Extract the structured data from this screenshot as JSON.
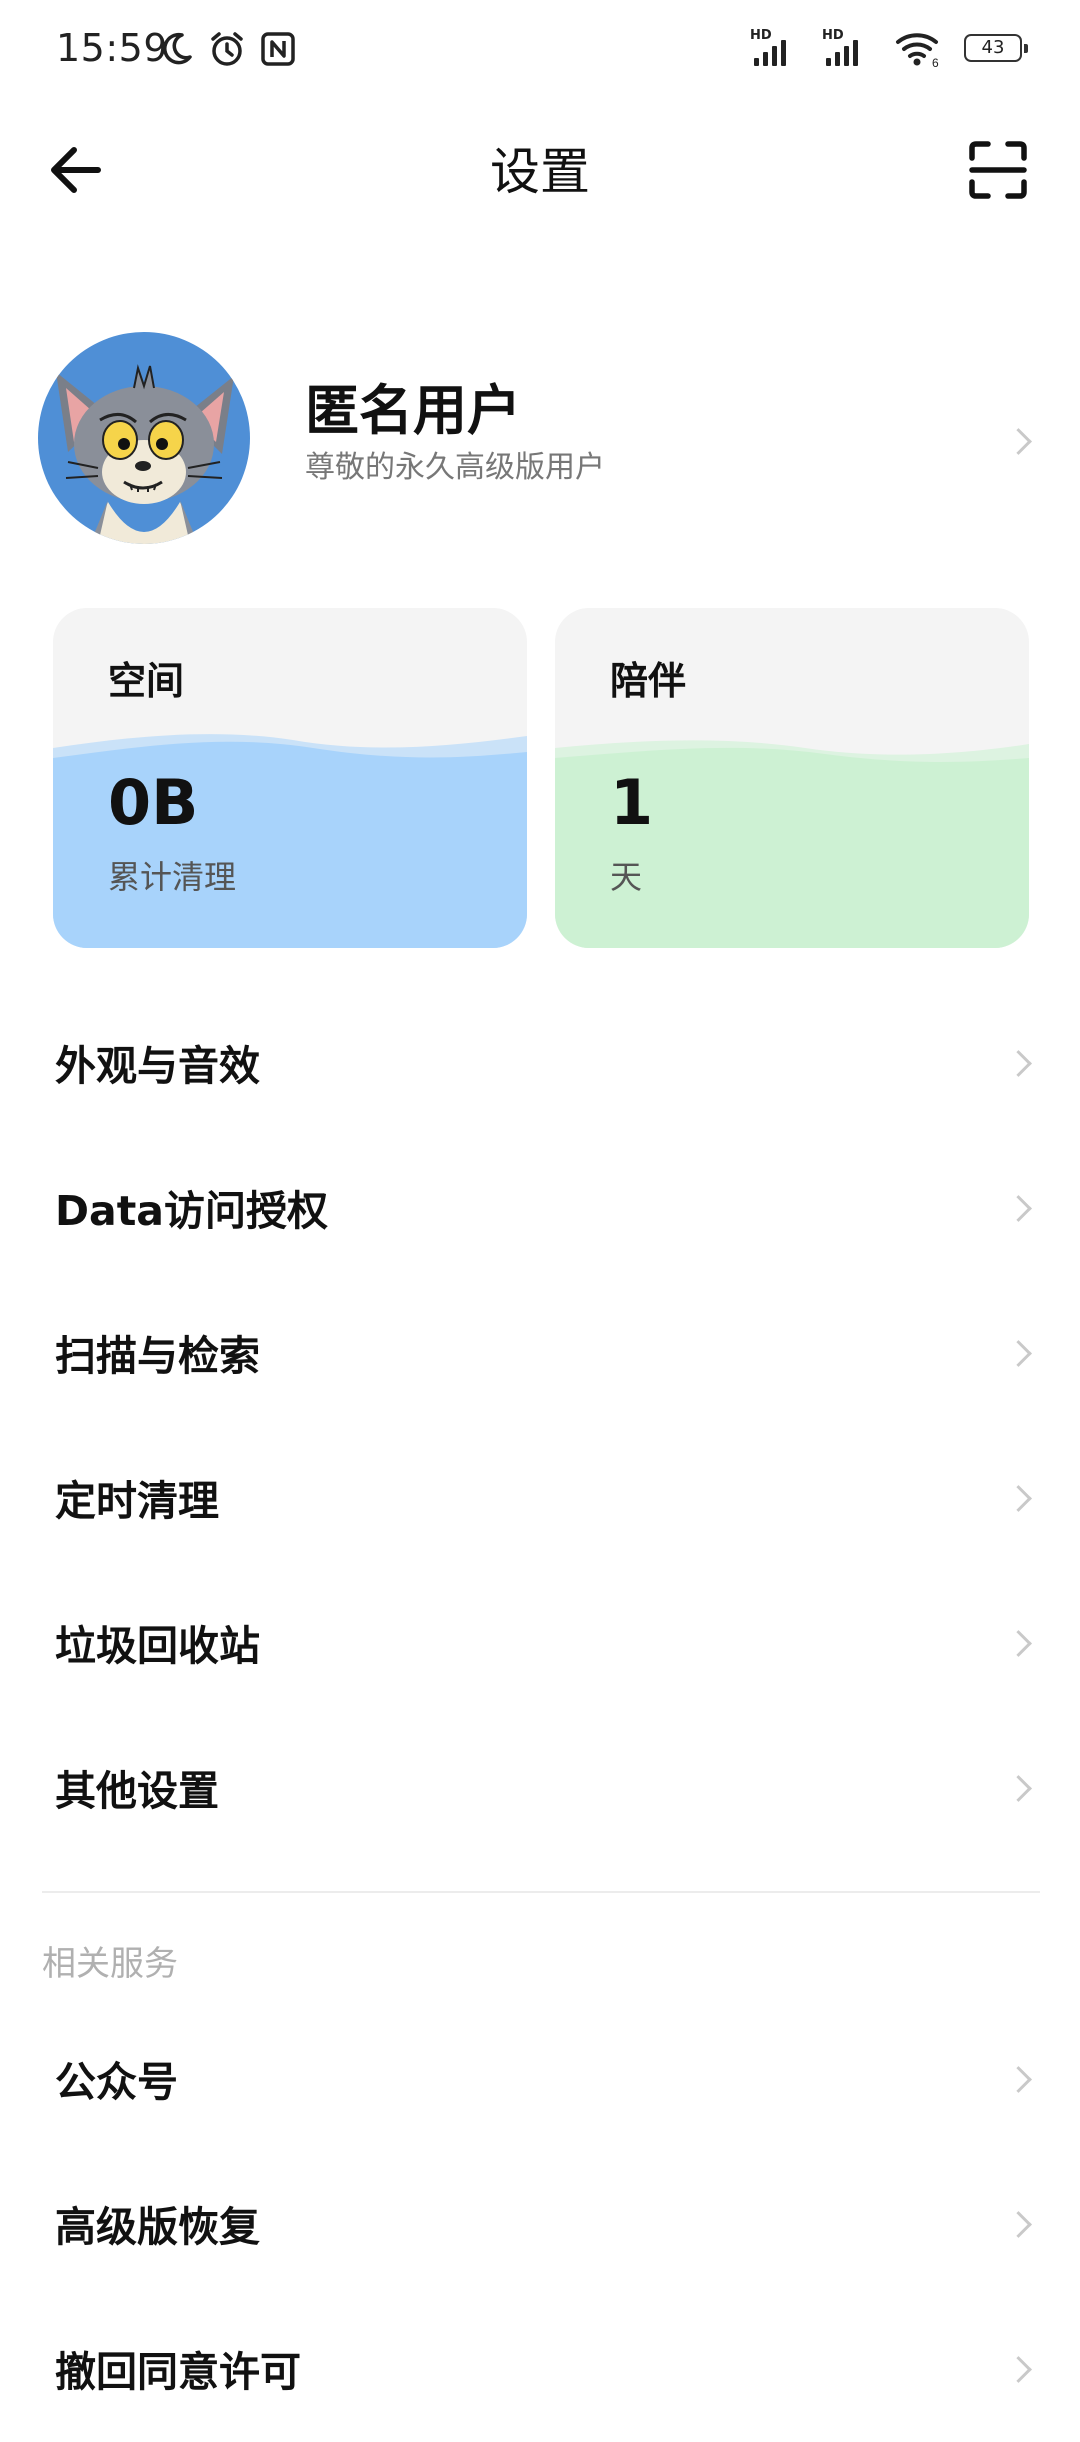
{
  "status_bar": {
    "time": "15:59",
    "battery": "43",
    "hd_label": "HD",
    "wifi_badge": "6",
    "left_icons": [
      "moon-icon",
      "alarm-icon",
      "nfc-icon"
    ],
    "right_icons": [
      "signal-hd-icon",
      "signal-hd-icon",
      "wifi-icon",
      "battery-icon"
    ]
  },
  "header": {
    "title": "设置",
    "back_icon": "arrow-left-icon",
    "scan_icon": "scan-icon"
  },
  "profile": {
    "name": "匿名用户",
    "subtitle": "尊敬的永久高级版用户"
  },
  "cards": {
    "space": {
      "title": "空间",
      "value": "0B",
      "caption": "累计清理",
      "color": "#a8d3fb"
    },
    "days": {
      "title": "陪伴",
      "value": "1",
      "caption": "天",
      "color": "#cdf1d3"
    }
  },
  "menu": {
    "items": [
      {
        "label": "外观与音效"
      },
      {
        "label": "Data访问授权"
      },
      {
        "label": "扫描与检索"
      },
      {
        "label": "定时清理"
      },
      {
        "label": "垃圾回收站"
      },
      {
        "label": "其他设置"
      }
    ]
  },
  "related": {
    "header": "相关服务",
    "items": [
      {
        "label": "公众号"
      },
      {
        "label": "高级版恢复"
      },
      {
        "label": "撤回同意许可"
      }
    ]
  }
}
